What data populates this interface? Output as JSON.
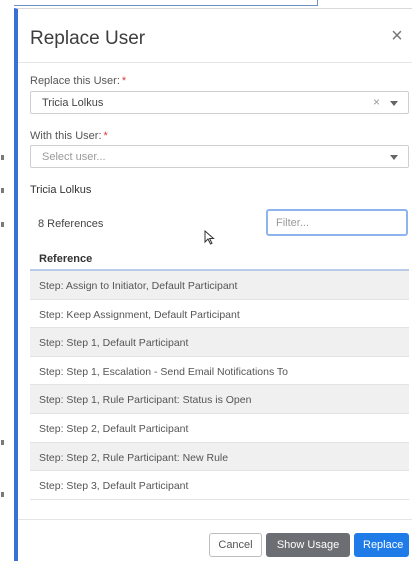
{
  "dialog": {
    "title": "Replace User",
    "close_glyph": "×"
  },
  "replace_field": {
    "label": "Replace this User:",
    "required_mark": "*",
    "value": "Tricia Lolkus",
    "clear_glyph": "×"
  },
  "with_field": {
    "label": "With this User:",
    "required_mark": "*",
    "placeholder": "Select user..."
  },
  "references": {
    "user_name": "Tricia Lolkus",
    "count_text": "8 References",
    "filter_placeholder": "Filter...",
    "column_header": "Reference",
    "rows": [
      "Step: Assign to Initiator, Default Participant",
      "Step: Keep Assignment, Default Participant",
      "Step: Step 1, Default Participant",
      "Step: Step 1, Escalation - Send Email Notifications To",
      "Step: Step 1, Rule Participant: Status is Open",
      "Step: Step 2, Default Participant",
      "Step: Step 2, Rule Participant: New Rule",
      "Step: Step 3, Default Participant"
    ]
  },
  "footer": {
    "cancel_label": "Cancel",
    "show_usage_label": "Show Usage",
    "replace_label": "Replace"
  },
  "colors": {
    "accent": "#1f7be8",
    "secondary_button": "#6b6e72",
    "required": "#e03a3a",
    "row_stripe": "#f0f0f0"
  }
}
